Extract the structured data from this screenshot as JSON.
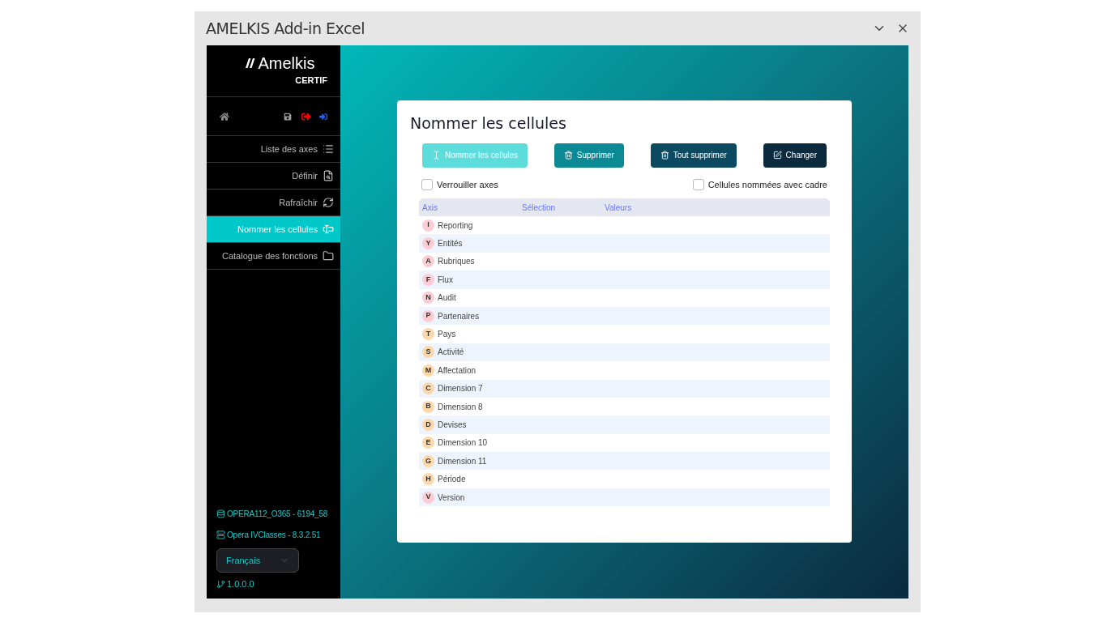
{
  "window": {
    "title": "AMELKIS Add-in Excel"
  },
  "sidebar": {
    "logo": {
      "name": "Amelkis",
      "subtitle": "CERTIF"
    },
    "items": [
      {
        "label": "Liste des axes",
        "kind": "list",
        "selected": false
      },
      {
        "label": "Définir",
        "kind": "define",
        "selected": false
      },
      {
        "label": "Rafraîchir",
        "kind": "refresh",
        "selected": false
      },
      {
        "label": "Nommer les cellules",
        "kind": "name",
        "selected": true
      },
      {
        "label": "Catalogue des fonctions",
        "kind": "catalog",
        "selected": false
      }
    ],
    "connections": [
      {
        "label": "OPERA112_O365 - 6194_58",
        "kind": "database"
      },
      {
        "label": "Opera IVClasses - 8.3.2.51",
        "kind": "server"
      }
    ],
    "language": {
      "value": "Français"
    },
    "version": "1.0.0.0"
  },
  "card": {
    "title": "Nommer les cellules",
    "buttons": [
      {
        "label": "Nommer les cellules",
        "kind": "name",
        "color": "#5ddcdc"
      },
      {
        "label": "Supprimer",
        "kind": "delete",
        "color": "#0b8a96"
      },
      {
        "label": "Tout supprimer",
        "kind": "delete",
        "color": "#0b4a60"
      },
      {
        "label": "Changer",
        "kind": "edit",
        "color": "#0b2a3e"
      }
    ],
    "options": [
      {
        "label": "Verrouiller axes",
        "checked": false
      },
      {
        "label": "Cellules nommées avec cadre",
        "checked": false
      }
    ],
    "table": {
      "columns": [
        "Axis",
        "Sélection",
        "Valeurs"
      ],
      "rows": [
        {
          "letter": "I",
          "name": "Reporting",
          "color": "#fecdd3"
        },
        {
          "letter": "Y",
          "name": "Entités",
          "color": "#fecdd3"
        },
        {
          "letter": "A",
          "name": "Rubriques",
          "color": "#fecdd3"
        },
        {
          "letter": "F",
          "name": "Flux",
          "color": "#fecdd3"
        },
        {
          "letter": "N",
          "name": "Audit",
          "color": "#fecdd3"
        },
        {
          "letter": "P",
          "name": "Partenaires",
          "color": "#fecdd3"
        },
        {
          "letter": "T",
          "name": "Pays",
          "color": "#fed7aa"
        },
        {
          "letter": "S",
          "name": "Activité",
          "color": "#fed7aa"
        },
        {
          "letter": "M",
          "name": "Affectation",
          "color": "#fed7aa"
        },
        {
          "letter": "C",
          "name": "Dimension 7",
          "color": "#fed7aa"
        },
        {
          "letter": "B",
          "name": "Dimension 8",
          "color": "#fed7aa"
        },
        {
          "letter": "D",
          "name": "Devises",
          "color": "#fed7aa"
        },
        {
          "letter": "E",
          "name": "Dimension 10",
          "color": "#fed7aa"
        },
        {
          "letter": "G",
          "name": "Dimension 11",
          "color": "#fed7aa"
        },
        {
          "letter": "H",
          "name": "Période",
          "color": "#fed7aa"
        },
        {
          "letter": "V",
          "name": "Version",
          "color": "#fecdd3"
        }
      ]
    }
  }
}
